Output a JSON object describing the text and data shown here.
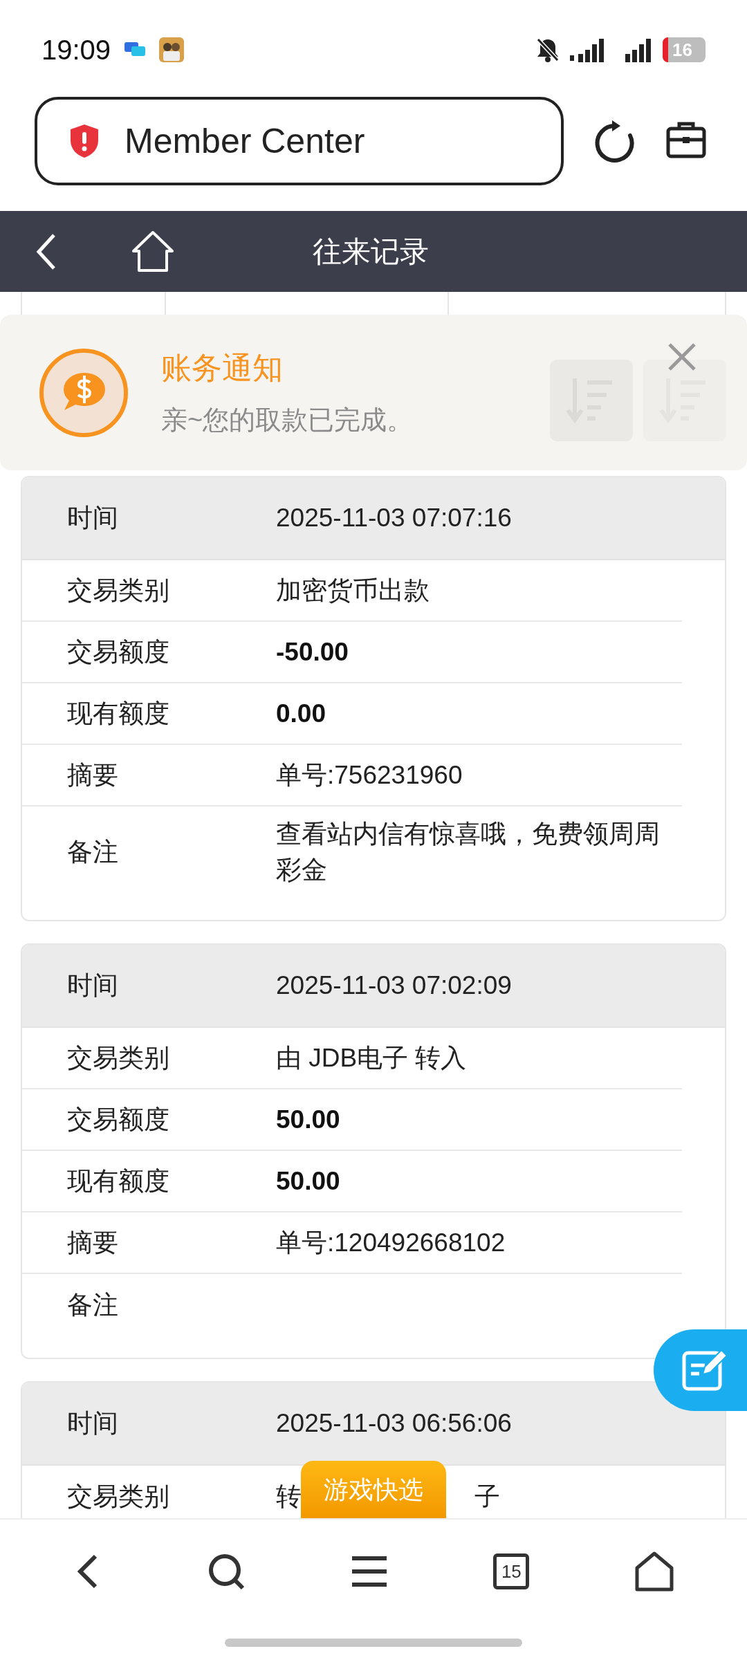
{
  "status_bar": {
    "time": "19:09",
    "battery": "16"
  },
  "address_bar": {
    "title": "Member Center"
  },
  "header": {
    "title": "往来记录"
  },
  "notification": {
    "title": "账务通知",
    "message": "亲~您的取款已完成。"
  },
  "records": [
    {
      "rows": [
        {
          "kind": "time",
          "label": "时间",
          "value": "2025-11-03 07:07:16"
        },
        {
          "kind": "plain",
          "label": "交易类别",
          "value": "加密货币出款"
        },
        {
          "kind": "bold",
          "label": "交易额度",
          "value": "-50.00"
        },
        {
          "kind": "bold",
          "label": "现有额度",
          "value": "0.00"
        },
        {
          "kind": "plain",
          "label": "摘要",
          "value": "单号:756231960"
        },
        {
          "kind": "plain",
          "label": "备注",
          "value": "查看站内信有惊喜哦，免费领周周彩金"
        }
      ]
    },
    {
      "rows": [
        {
          "kind": "time",
          "label": "时间",
          "value": "2025-11-03 07:02:09"
        },
        {
          "kind": "plain",
          "label": "交易类别",
          "value": "由 JDB电子 转入"
        },
        {
          "kind": "bold",
          "label": "交易额度",
          "value": "50.00"
        },
        {
          "kind": "bold",
          "label": "现有额度",
          "value": "50.00"
        },
        {
          "kind": "plain",
          "label": "摘要",
          "value": "单号:120492668102"
        },
        {
          "kind": "plain",
          "label": "备注"
        }
      ]
    },
    {
      "rows": [
        {
          "kind": "time",
          "label": "时间",
          "value": "2025-11-03 06:56:06"
        },
        {
          "kind": "covered",
          "label": "交易类别",
          "value_parts": [
            "转",
            "子"
          ]
        }
      ]
    }
  ],
  "quick_pick": {
    "label": "游戏快选"
  },
  "bottom_nav": {
    "tab_count": "15"
  }
}
